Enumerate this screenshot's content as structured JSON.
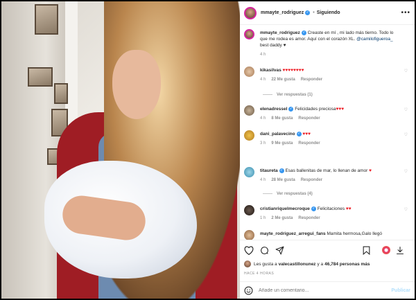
{
  "post": {
    "username": "mmayte_rodriguez",
    "follow_status": "Siguiendo",
    "more_icon": "more-dots-icon"
  },
  "caption": {
    "username": "mmayte_rodriguez",
    "text": "Creaste en mí , mi lado más tierno. Todo lo que me rodea es amor. Aquí con el corazón XL.",
    "mention": "@camilofigueroa_",
    "tail": " best daddy ♥",
    "time": "4 h"
  },
  "comments": [
    {
      "username": "kikasilvas",
      "text": "",
      "emoji": "♥♥♥♥♥♥♥♥",
      "time": "4 h",
      "likes": "22 Me gusta",
      "reply": "Responder",
      "replies": "Ver respuestas (1)"
    },
    {
      "username": "elenadressel",
      "text": "Felicidades preciosa",
      "emoji": "♥♥♥",
      "time": "4 h",
      "likes": "8 Me gusta",
      "reply": "Responder",
      "replies": ""
    },
    {
      "username": "dani_palavecino",
      "text": "",
      "emoji": "♥♥♥",
      "time": "3 h",
      "likes": "9 Me gusta",
      "reply": "Responder",
      "replies": ""
    },
    {
      "username": "titaureta",
      "text": "Esas ballenitas de mar, lo llenan de amor",
      "emoji": "♥",
      "time": "4 h",
      "likes": "28 Me gusta",
      "reply": "Responder",
      "replies": "Ver respuestas (4)"
    },
    {
      "username": "cristianriquelmecroque",
      "text": "Felicitaciones",
      "emoji": "♥♥",
      "time": "1 h",
      "likes": "2 Me gusta",
      "reply": "Responder",
      "replies": ""
    },
    {
      "username": "mayte_rodriguez_arregui_fans",
      "text": "Mamita hermosa,Galo llegó",
      "emoji": "",
      "time": "",
      "likes": "",
      "reply": "",
      "replies": ""
    }
  ],
  "actions": {
    "liked_by": "Les gusta a valecastillonunez y a 46,784 personas más",
    "liked_by_prefix": "Les gusta a ",
    "liked_user": "valecastillonunez",
    "liked_mid": " y a ",
    "liked_count": "46,784 personas más",
    "ago": "HACE 4 HORAS"
  },
  "composer": {
    "placeholder": "Añade un comentario...",
    "publish": "Publicar"
  },
  "colors": {
    "verified": "#3897f0",
    "heart": "#ed1c24",
    "publish_disabled": "#b2dffc"
  }
}
